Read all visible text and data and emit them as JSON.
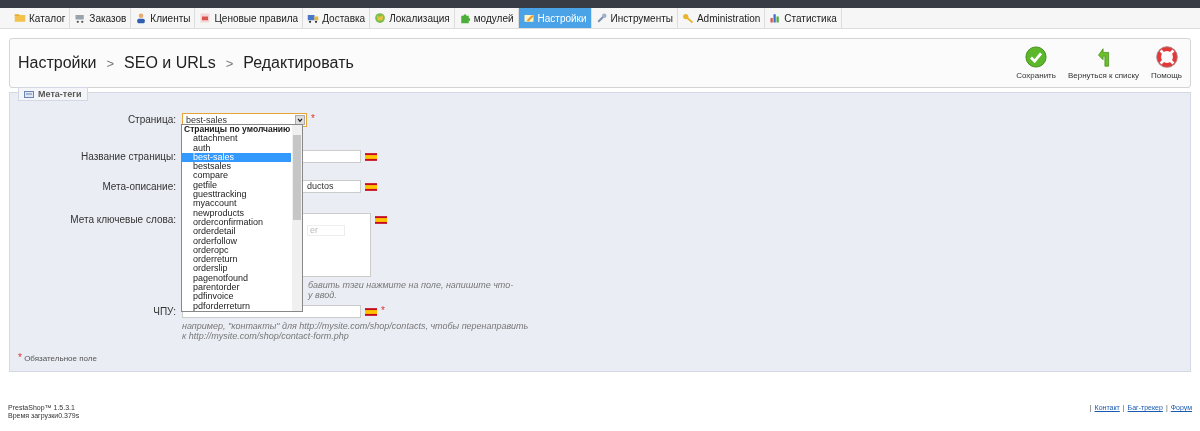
{
  "top_tabs": [
    {
      "label": "Каталог",
      "selected": false
    },
    {
      "label": "Заказов",
      "selected": false
    },
    {
      "label": "Клиенты",
      "selected": false
    },
    {
      "label": "Ценовые правила",
      "selected": false
    },
    {
      "label": "Доставка",
      "selected": false
    },
    {
      "label": "Локализация",
      "selected": false
    },
    {
      "label": "модулей",
      "selected": false
    },
    {
      "label": "Настройки",
      "selected": true
    },
    {
      "label": "Инструменты",
      "selected": false
    },
    {
      "label": "Administration",
      "selected": false
    },
    {
      "label": "Статистика",
      "selected": false
    }
  ],
  "breadcrumb": [
    "Настройки",
    "SEO и URLs",
    "Редактировать"
  ],
  "breadcrumb_separator": ">",
  "toolbar": [
    {
      "label": "Сохранить",
      "kind": "save"
    },
    {
      "label": "Вернуться к списку",
      "kind": "back"
    },
    {
      "label": "Помощь",
      "kind": "help"
    }
  ],
  "fieldset": {
    "legend": "Мета-теги",
    "fields": [
      {
        "kind": "select",
        "label": "Страница:",
        "value": "best-sales",
        "required_mark": "*",
        "dropdown": {
          "group": "Страницы по умолчанию",
          "options": [
            {
              "label": "attachment",
              "selected": false
            },
            {
              "label": "auth",
              "selected": false
            },
            {
              "label": "best-sales",
              "selected": true
            },
            {
              "label": "bestsales",
              "selected": false
            },
            {
              "label": "compare",
              "selected": false
            },
            {
              "label": "getfile",
              "selected": false
            },
            {
              "label": "guesttracking",
              "selected": false
            },
            {
              "label": "myaccount",
              "selected": false
            },
            {
              "label": "newproducts",
              "selected": false
            },
            {
              "label": "orderconfirmation",
              "selected": false
            },
            {
              "label": "orderdetail",
              "selected": false
            },
            {
              "label": "orderfollow",
              "selected": false
            },
            {
              "label": "orderopc",
              "selected": false
            },
            {
              "label": "orderreturn",
              "selected": false
            },
            {
              "label": "orderslip",
              "selected": false
            },
            {
              "label": "pagenotfound",
              "selected": false
            },
            {
              "label": "parentorder",
              "selected": false
            },
            {
              "label": "pdfinvoice",
              "selected": false
            },
            {
              "label": "pdforderreturn",
              "selected": false
            }
          ]
        }
      },
      {
        "kind": "text",
        "label": "Название страницы:",
        "flag": true
      },
      {
        "kind": "text",
        "label": "Мета-описание:",
        "value": "ductos",
        "flag": true
      },
      {
        "kind": "tags",
        "label": "Мета ключевые слова:",
        "placeholder": "er",
        "flag": true,
        "hint": [
          "бавить тэги нажмите на поле, напишите что-",
          "у ввод."
        ]
      },
      {
        "kind": "text",
        "label": "ЧПУ:",
        "flag": true,
        "required_mark": "*",
        "hint": [
          "например, \"контакты\" для http://mysite.com/shop/contacts, чтобы перенаправить",
          "к http://mysite.com/shop/contact-form.php"
        ]
      }
    ],
    "required_note": {
      "mark": "*",
      "text": "Обязательное поле"
    }
  },
  "footer": {
    "version": "PrestaShop™ 1.5.3.1",
    "load_time": "Время загрузки0.379s",
    "separator": "|",
    "links": [
      "Контакт",
      "Баг-трекер",
      "Форум"
    ]
  }
}
